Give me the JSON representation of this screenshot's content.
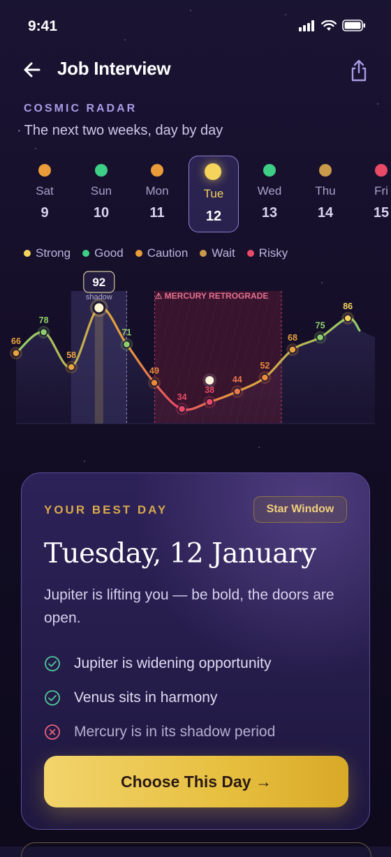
{
  "status": {
    "time": "9:41"
  },
  "header": {
    "title": "Job Interview"
  },
  "section": {
    "kicker": "COSMIC RADAR",
    "subtitle": "The next two weeks, day by day"
  },
  "days": [
    {
      "name": "Sat",
      "num": "9",
      "color": "#e99c39"
    },
    {
      "name": "Sun",
      "num": "10",
      "color": "#3ecf86"
    },
    {
      "name": "Mon",
      "num": "11",
      "color": "#e99c39"
    },
    {
      "name": "Tue",
      "num": "12",
      "color": "#f4d45b",
      "selected": true
    },
    {
      "name": "Wed",
      "num": "13",
      "color": "#3ecf86"
    },
    {
      "name": "Thu",
      "num": "14",
      "color": "#c99a4a"
    },
    {
      "name": "Fri",
      "num": "15",
      "color": "#e94a67"
    }
  ],
  "legend": [
    {
      "label": "Strong",
      "color": "#f4d45b"
    },
    {
      "label": "Good",
      "color": "#3ecf86"
    },
    {
      "label": "Caution",
      "color": "#e99c39"
    },
    {
      "label": "Wait",
      "color": "#c99a4a"
    },
    {
      "label": "Risky",
      "color": "#e94a67"
    }
  ],
  "chart_data": {
    "type": "line",
    "x": [
      1,
      2,
      3,
      4,
      5,
      6,
      7,
      8,
      9,
      10,
      11,
      12,
      13,
      14
    ],
    "values": [
      66,
      78,
      58,
      92,
      71,
      49,
      34,
      38,
      44,
      52,
      68,
      75,
      86,
      79
    ],
    "value_labels": [
      "66",
      "78",
      "58",
      "92",
      "71",
      "49",
      "34",
      "38",
      "44",
      "52",
      "68",
      "75",
      "86",
      ""
    ],
    "highlight_index": 3,
    "highlight_label": "92",
    "shadow_label": "shadow",
    "retrograde_label": "⚠ MERCURY RETROGRADE",
    "retrograde_range": [
      6,
      10
    ],
    "shadow_range": [
      3,
      5
    ],
    "colors": {
      "line_high": "#8fd06b",
      "line_mid": "#e99c39",
      "line_low": "#e94a67"
    }
  },
  "best_day": {
    "kicker": "YOUR BEST DAY",
    "badge": "Star Window",
    "date": "Tuesday, 12 January",
    "description": "Jupiter is lifting you — be bold, the doors are open.",
    "reasons": [
      {
        "text": "Jupiter is widening opportunity",
        "type": "good"
      },
      {
        "text": "Venus sits in harmony",
        "type": "good"
      },
      {
        "text": "Mercury is in its shadow period",
        "type": "bad"
      }
    ],
    "cta": "Choose This Day →"
  }
}
